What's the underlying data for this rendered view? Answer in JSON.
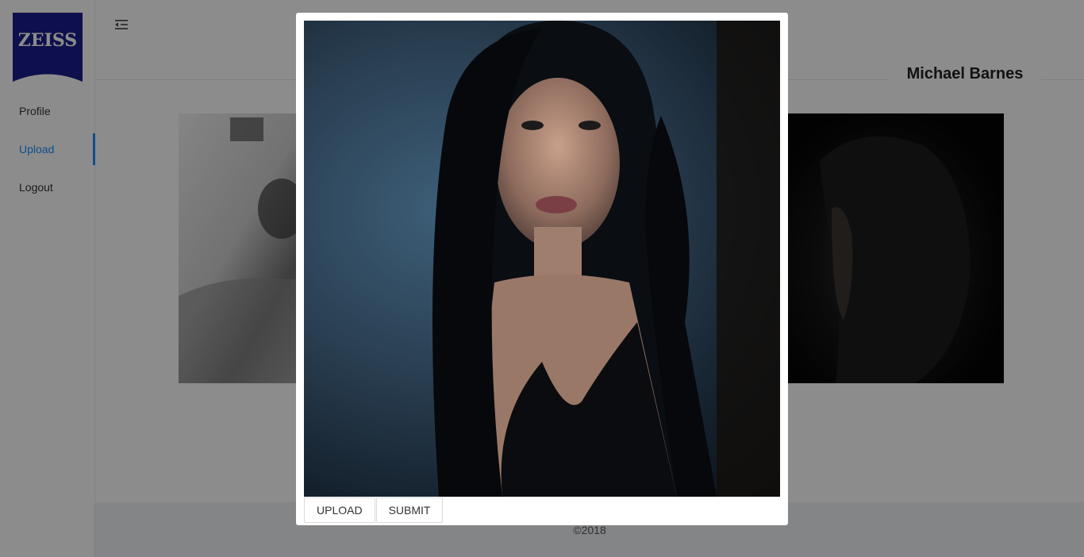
{
  "brand": {
    "logo_text": "ZEISS",
    "logo_color": "#1b1e8c"
  },
  "sidebar": {
    "items": [
      {
        "label": "Profile",
        "active": false
      },
      {
        "label": "Upload",
        "active": true
      },
      {
        "label": "Logout",
        "active": false
      }
    ],
    "accent_color": "#1890ff"
  },
  "header": {
    "menu_toggle_icon": "menu-fold-icon"
  },
  "profile": {
    "user_name": "Michael Barnes"
  },
  "gallery": {
    "photos": [
      {
        "description_icon": "photo-icon"
      },
      {
        "description_icon": "photo-icon"
      }
    ]
  },
  "footer": {
    "copyright": "©2018"
  },
  "modal": {
    "preview_icon": "photo-icon",
    "upload_label": "UPLOAD",
    "submit_label": "SUBMIT"
  }
}
